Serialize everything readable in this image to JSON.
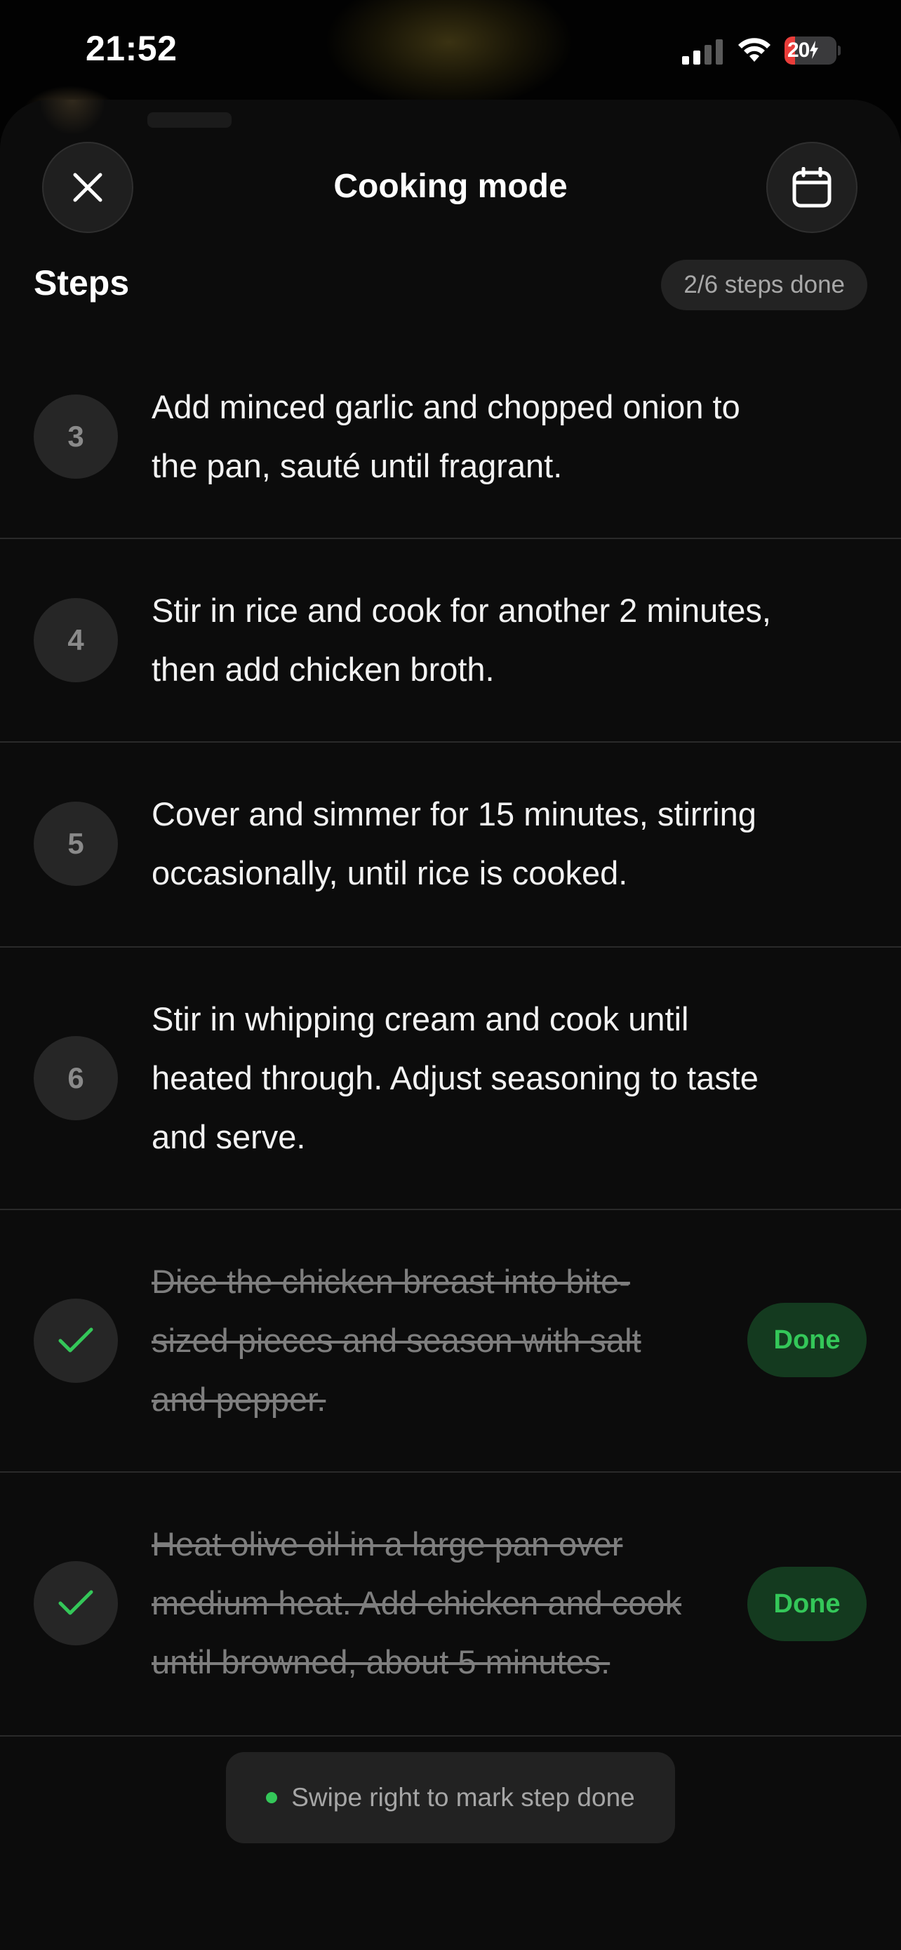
{
  "status_bar": {
    "time": "21:52",
    "battery_level": "20",
    "battery_fill_percent": 20,
    "signal_icon": "cellular-signal-icon",
    "wifi_icon": "wifi-icon",
    "battery_icon": "battery-charging-icon"
  },
  "header": {
    "title": "Cooking mode",
    "close_icon": "close-icon",
    "calendar_icon": "calendar-icon"
  },
  "steps_section": {
    "heading": "Steps",
    "progress": "2/6 steps done"
  },
  "steps": [
    {
      "number": "3",
      "line1": "Add minced garlic and chopped onion to",
      "line2": "the pan, sauté until fragrant.",
      "done": false
    },
    {
      "number": "4",
      "line1": "Stir in rice and cook for another 2 minutes,",
      "line2": "then add chicken broth.",
      "done": false
    },
    {
      "number": "5",
      "line1": "Cover and simmer for 15 minutes, stirring",
      "line2": "occasionally, until rice is cooked.",
      "done": false
    },
    {
      "number": "6",
      "line1": "Stir in whipping cream and cook until",
      "line2": "heated through. Adjust seasoning to taste",
      "line3": "and serve.",
      "done": false
    },
    {
      "line1": "Dice the chicken breast into bite-",
      "line2": "sized pieces and season with salt",
      "line3": "and pepper.",
      "done": true,
      "badge": "Done"
    },
    {
      "line1": "Heat olive oil in a large pan over",
      "line2": "medium heat. Add chicken and cook",
      "line3": "until browned, about 5 minutes.",
      "done": true,
      "badge": "Done"
    }
  ],
  "toast": {
    "text": "Swipe right to mark step done"
  },
  "colors": {
    "accent_green": "#34c759",
    "done_badge_bg": "#143a1f",
    "battery_low": "#ea3d3a"
  }
}
